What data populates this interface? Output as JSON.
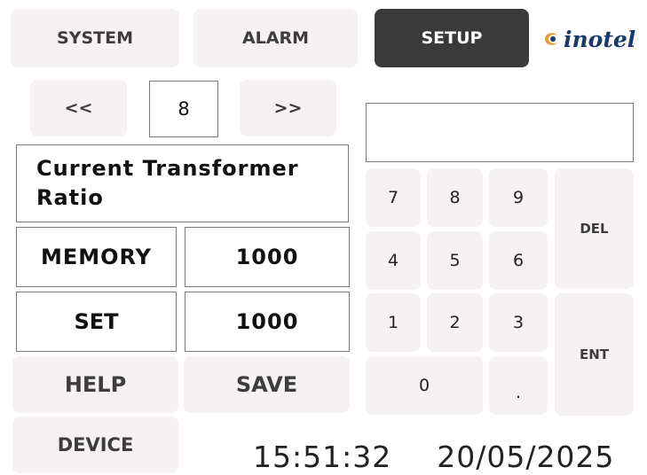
{
  "tabs": {
    "system": "SYSTEM",
    "alarm": "ALARM",
    "setup": "SETUP"
  },
  "logo": {
    "text": "inotel"
  },
  "pager": {
    "prev": "<<",
    "page": "8",
    "next": ">>"
  },
  "parameter": {
    "name": "Current Transformer Ratio",
    "memory_label": "MEMORY",
    "memory_value": "1000",
    "set_label": "SET",
    "set_value": "1000"
  },
  "buttons": {
    "help": "HELP",
    "save": "SAVE",
    "device": "DEVICE"
  },
  "keypad": {
    "display": "",
    "k7": "7",
    "k8": "8",
    "k9": "9",
    "k4": "4",
    "k5": "5",
    "k6": "6",
    "k1": "1",
    "k2": "2",
    "k3": "3",
    "k0": "0",
    "kdot": ".",
    "del": "DEL",
    "ent": "ENT"
  },
  "status": {
    "time": "15:51:32",
    "date": "20/05/2025"
  },
  "colors": {
    "active_tab": "#3a3a3a",
    "button_bg": "#f6f2f4",
    "logo": "#1b3a6b",
    "logo_accent": "#f09a2a"
  }
}
